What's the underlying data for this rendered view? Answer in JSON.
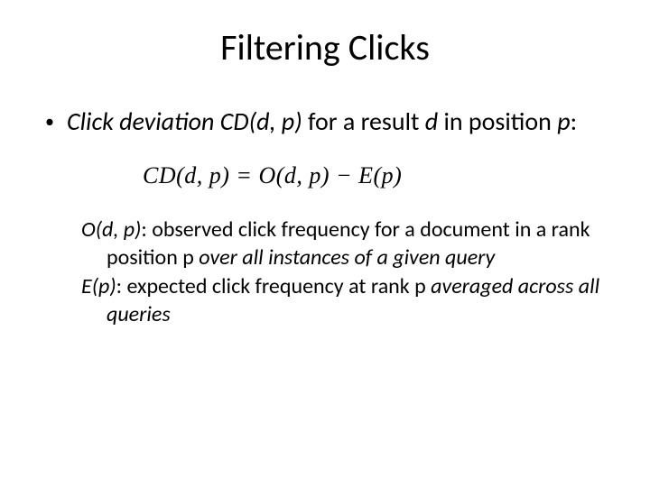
{
  "title": "Filtering Clicks",
  "bullet": {
    "dot": "•",
    "seg1": "Click deviation CD(d, p)",
    "seg2": " for a result ",
    "seg3": "d",
    "seg4": " in position ",
    "seg5": "p",
    "seg6": ":"
  },
  "equation": "CD(d, p) = O(d, p) − E(p)",
  "defs": {
    "o": {
      "term": "O(d, p)",
      "mid": ": observed click frequency for a document in a rank position p ",
      "tail_italic": "over all instances of a given query"
    },
    "e": {
      "term": "E(p)",
      "mid": ": expected click frequency at rank p ",
      "tail_italic": "averaged across all queries"
    }
  }
}
